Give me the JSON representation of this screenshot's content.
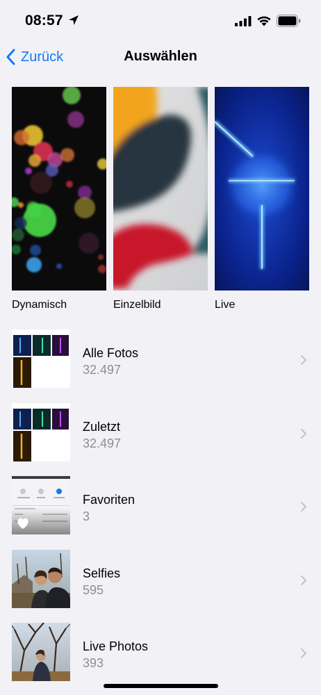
{
  "status_bar": {
    "time": "08:57"
  },
  "nav": {
    "back_label": "Zurück",
    "title": "Auswählen"
  },
  "wallpapers": [
    {
      "label": "Dynamisch"
    },
    {
      "label": "Einzelbild"
    },
    {
      "label": "Live"
    }
  ],
  "albums": [
    {
      "name": "Alle Fotos",
      "count": "32.497"
    },
    {
      "name": "Zuletzt",
      "count": "32.497"
    },
    {
      "name": "Favoriten",
      "count": "3"
    },
    {
      "name": "Selfies",
      "count": "595"
    },
    {
      "name": "Live Photos",
      "count": "393"
    }
  ],
  "colors": {
    "accent": "#1478f5",
    "background": "#f2f1f6",
    "secondary_text": "#8e8e93",
    "chevron": "#c4c4c7"
  }
}
